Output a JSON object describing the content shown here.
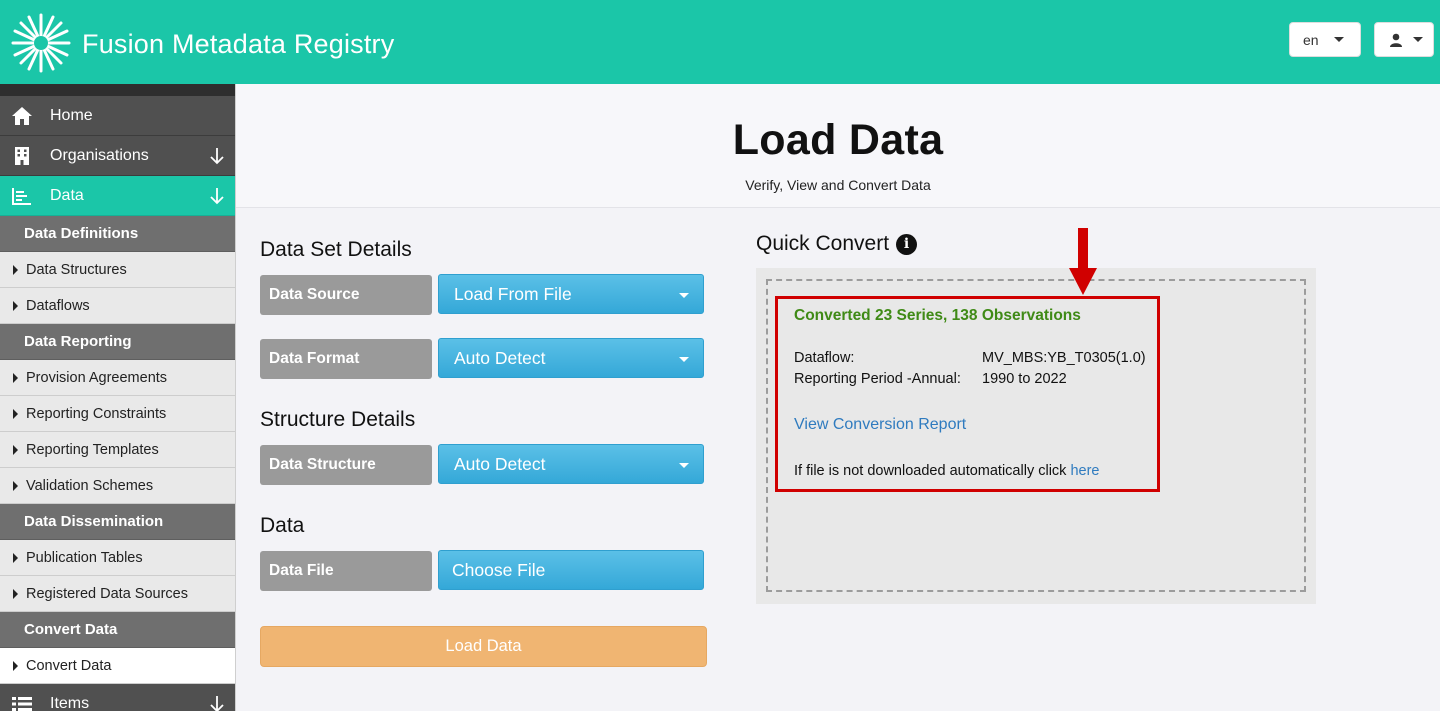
{
  "header": {
    "brand": "Fusion Metadata Registry",
    "language": "en"
  },
  "sidebar": {
    "home": "Home",
    "organisations": "Organisations",
    "data": "Data",
    "items_label": "Items",
    "sections": {
      "definitions": "Data Definitions",
      "reporting": "Data Reporting",
      "dissemination": "Data Dissemination",
      "convert": "Convert Data"
    },
    "definitions_items": [
      "Data Structures",
      "Dataflows"
    ],
    "reporting_items": [
      "Provision Agreements",
      "Reporting Constraints",
      "Reporting Templates",
      "Validation Schemes"
    ],
    "dissemination_items": [
      "Publication Tables",
      "Registered Data Sources"
    ],
    "convert_items": [
      "Convert Data"
    ]
  },
  "page": {
    "title": "Load Data",
    "subtitle": "Verify, View and Convert Data"
  },
  "form": {
    "dataset_heading": "Data Set Details",
    "data_source_label": "Data Source",
    "data_source_value": "Load From File",
    "data_format_label": "Data Format",
    "data_format_value": "Auto Detect",
    "structure_heading": "Structure Details",
    "data_structure_label": "Data Structure",
    "data_structure_value": "Auto Detect",
    "data_heading": "Data",
    "data_file_label": "Data File",
    "choose_file": "Choose File",
    "load_button": "Load Data"
  },
  "quick_convert": {
    "title": "Quick Convert",
    "success": "Converted 23 Series, 138 Observations",
    "dataflow_label": "Dataflow:",
    "dataflow_value": "MV_MBS:YB_T0305(1.0)",
    "period_label": "Reporting Period -Annual:",
    "period_value": "1990 to 2022",
    "report_link": "View Conversion Report",
    "download_note": "If file is not downloaded automatically click",
    "download_link": "here"
  },
  "colors": {
    "brand": "#1bc6a8",
    "control": "#3fb0dd",
    "load_button": "#f0b572",
    "success": "#3f8a16",
    "highlight": "#d00000"
  }
}
